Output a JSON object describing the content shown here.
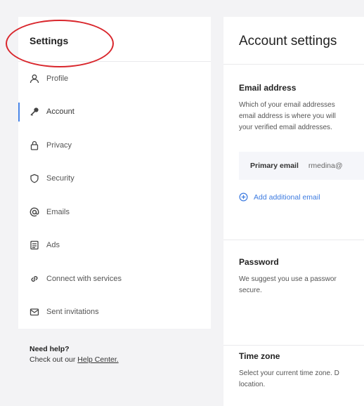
{
  "sidebar": {
    "title": "Settings",
    "items": [
      {
        "label": "Profile",
        "icon": "user-icon"
      },
      {
        "label": "Account",
        "icon": "key-icon",
        "active": true
      },
      {
        "label": "Privacy",
        "icon": "lock-icon"
      },
      {
        "label": "Security",
        "icon": "shield-icon"
      },
      {
        "label": "Emails",
        "icon": "at-icon"
      },
      {
        "label": "Ads",
        "icon": "ads-icon"
      },
      {
        "label": "Connect with services",
        "icon": "link-icon"
      },
      {
        "label": "Sent invitations",
        "icon": "mail-icon"
      }
    ]
  },
  "help": {
    "title": "Need help?",
    "text": "Check out our",
    "link": "Help Center."
  },
  "main": {
    "title": "Account settings",
    "email": {
      "title": "Email address",
      "description_lines": [
        "Which of your email addresses",
        "email address is where you will",
        "your verified email addresses."
      ],
      "primary_label": "Primary email",
      "primary_value": "rmedina@",
      "add_label": "Add additional email"
    },
    "password": {
      "title": "Password",
      "description_lines": [
        "We suggest you use a passwor",
        "secure."
      ]
    },
    "timezone": {
      "title": "Time zone",
      "description_lines": [
        "Select your current time zone. D",
        "location."
      ]
    }
  },
  "colors": {
    "accent": "#3d7be0",
    "annotation": "#d9262c",
    "background": "#f3f3f5"
  }
}
